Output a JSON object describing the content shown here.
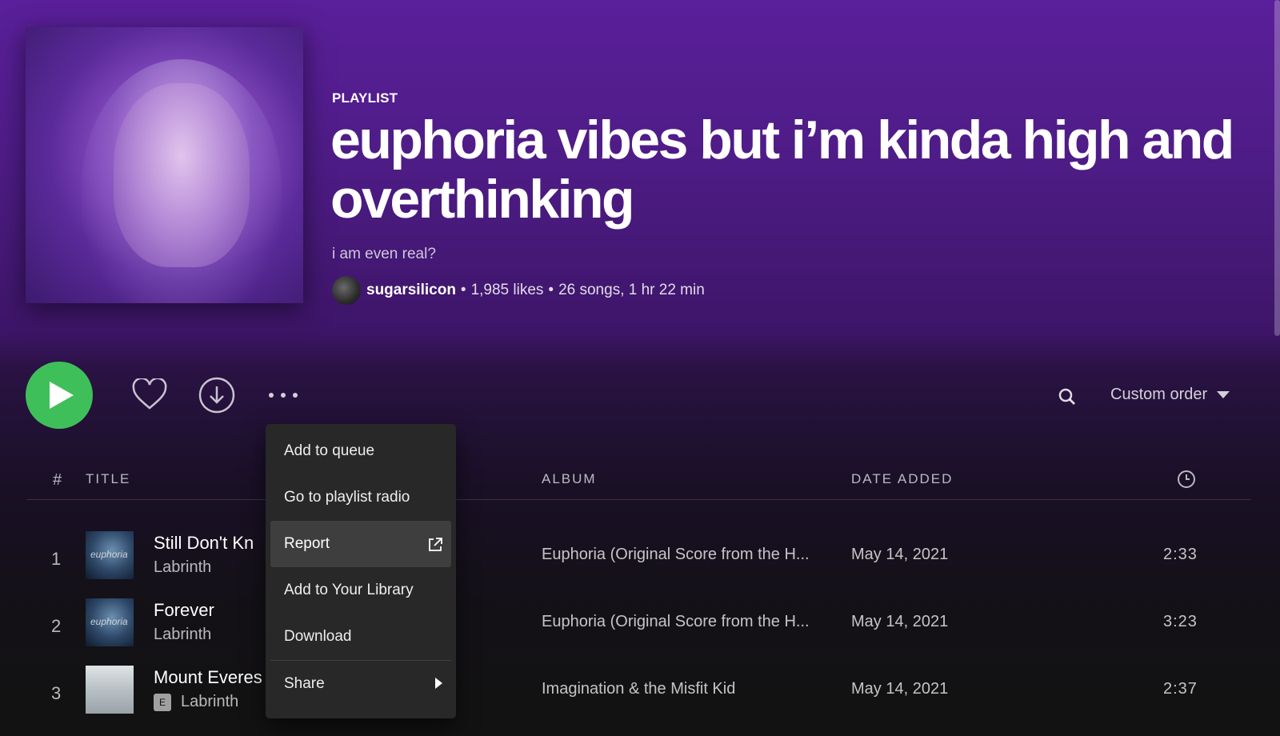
{
  "header": {
    "type_label": "PLAYLIST",
    "title": "euphoria vibes but i’m kinda high and overthinking",
    "description": "i am even real?",
    "owner": "sugarsilicon",
    "likes": "1,985 likes",
    "stats": "26 songs, 1 hr 22 min",
    "separator": "•"
  },
  "actions": {
    "play_icon": "play-icon",
    "like_icon": "heart-icon",
    "download_icon": "download-icon",
    "more_icon": "more-icon",
    "search_icon": "search-icon",
    "sort_label": "Custom order"
  },
  "table": {
    "headers": {
      "num": "#",
      "title": "TITLE",
      "album": "ALBUM",
      "date": "DATE ADDED",
      "duration_icon": "clock-icon"
    },
    "rows": [
      {
        "num": "1",
        "title": "Still Don't Kn",
        "artist": "Labrinth",
        "explicit": "",
        "album": "Euphoria (Original Score from the H...",
        "date": "May 14, 2021",
        "duration": "2:33",
        "thumb_text": "euphoria"
      },
      {
        "num": "2",
        "title": "Forever",
        "artist": "Labrinth",
        "explicit": "",
        "album": "Euphoria (Original Score from the H...",
        "date": "May 14, 2021",
        "duration": "3:23",
        "thumb_text": "euphoria"
      },
      {
        "num": "3",
        "title": "Mount Everes",
        "artist": "Labrinth",
        "explicit": "E",
        "album": "Imagination & the Misfit Kid",
        "date": "May 14, 2021",
        "duration": "2:37",
        "thumb_text": ""
      }
    ]
  },
  "context_menu": {
    "items": [
      {
        "label": "Add to queue"
      },
      {
        "label": "Go to playlist radio"
      },
      {
        "label": "Report",
        "trailing_icon": "external-link-icon",
        "active": true
      },
      {
        "label": "Add to Your Library"
      },
      {
        "label": "Download"
      },
      {
        "label": "Share",
        "trailing_icon": "submenu-arrow-icon"
      }
    ]
  },
  "colors": {
    "accent_green": "#1ed760",
    "header_purple": "#5a1f9a",
    "background": "#121212",
    "menu_bg": "#282828",
    "menu_active": "#3e3e3e"
  }
}
